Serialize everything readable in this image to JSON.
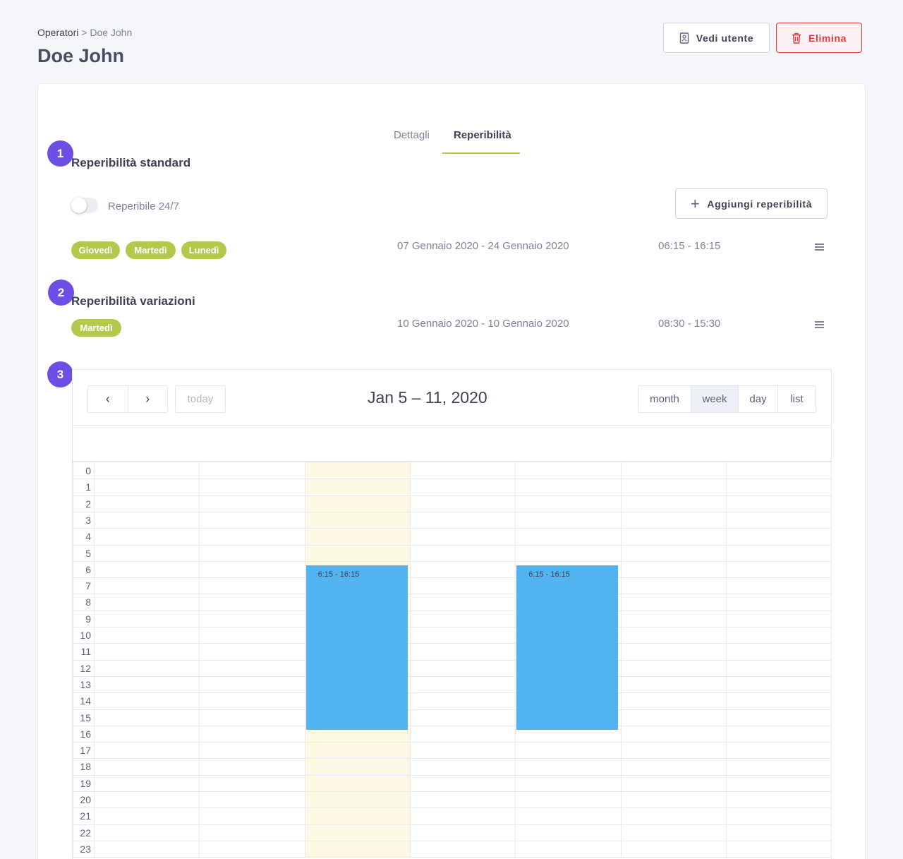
{
  "breadcrumb": {
    "root": "Operatori",
    "separator": ">",
    "current": "Doe John"
  },
  "page_title": "Doe John",
  "header_buttons": {
    "view_user": "Vedi utente",
    "delete": "Elimina"
  },
  "tabs": [
    {
      "label": "Dettagli"
    },
    {
      "label": "Reperibilità"
    }
  ],
  "steps": [
    "1",
    "2",
    "3"
  ],
  "standard": {
    "title": "Reperibilità standard",
    "toggle_label": "Reperibile 24/7",
    "toggle_on": false,
    "add_button": "Aggiungi reperibilità",
    "days": [
      "Giovedì",
      "Martedì",
      "Lunedì"
    ],
    "date_range": "07 Gennaio 2020 - 24 Gennaio 2020",
    "time_range": "06:15 - 16:15"
  },
  "variations": {
    "title": "Reperibilità variazioni",
    "days": [
      "Martedì"
    ],
    "date_range": "10 Gennaio 2020 - 10 Gennaio 2020",
    "time_range": "08:30 - 15:30"
  },
  "calendar": {
    "prev_icon": "chevron-left-icon",
    "next_icon": "chevron-right-icon",
    "today_label": "today",
    "title": "Jan 5 – 11, 2020",
    "views": [
      "month",
      "week",
      "day",
      "list"
    ],
    "active_view": "week",
    "hours": [
      "0",
      "1",
      "2",
      "3",
      "4",
      "5",
      "6",
      "7",
      "8",
      "9",
      "10",
      "11",
      "12",
      "13",
      "14",
      "15",
      "16",
      "17",
      "18",
      "19",
      "20",
      "21",
      "22",
      "23"
    ],
    "highlighted_day_index": 2,
    "events": [
      {
        "day_index": 2,
        "start": 6.25,
        "end": 16.25,
        "label": "6:15 - 16:15"
      },
      {
        "day_index": 4,
        "start": 6.25,
        "end": 16.25,
        "label": "6:15 - 16:15"
      }
    ]
  },
  "colors": {
    "accent": "#b5c84c",
    "step": "#6e4fe6",
    "event": "#52b3f1",
    "danger": "#e03a3c",
    "today": "#fcf8e3"
  }
}
